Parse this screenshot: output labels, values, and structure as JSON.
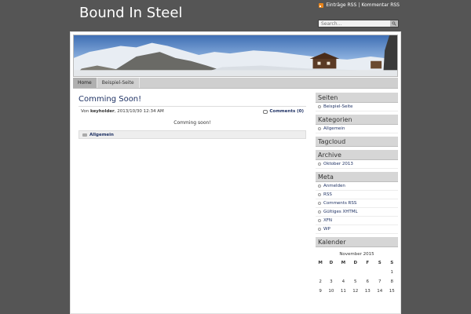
{
  "site": {
    "title": "Bound In Steel"
  },
  "header": {
    "rss_entries": "Einträge RSS",
    "separator": "|",
    "rss_comments": "Kommentar RSS",
    "search_placeholder": "Search..."
  },
  "nav": {
    "items": [
      {
        "label": "Home",
        "active": true
      },
      {
        "label": "Beispiel-Seite",
        "active": false
      }
    ]
  },
  "post": {
    "title": "Comming Soon!",
    "author_prefix": "Von",
    "author": "keyholder",
    "date": ", 2013/10/30 12:34 AM",
    "comments": "Comments (0)",
    "body": "Comming soon!",
    "category": "Allgemein"
  },
  "sidebar": {
    "pages_title": "Seiten",
    "pages": [
      "Beispiel-Seite"
    ],
    "categories_title": "Kategorien",
    "categories": [
      "Allgemein"
    ],
    "tagcloud_title": "Tagcloud",
    "archive_title": "Archive",
    "archive": [
      "Oktober 2013"
    ],
    "meta_title": "Meta",
    "meta": [
      "Anmelden",
      "RSS",
      "Comments RSS",
      "Gültiges XHTML",
      "XFN",
      "WP"
    ],
    "calendar_title": "Kalender"
  },
  "calendar": {
    "caption": "November 2015",
    "days": [
      "M",
      "D",
      "M",
      "D",
      "F",
      "S",
      "S"
    ],
    "weeks": [
      [
        "",
        "",
        "",
        "",
        "",
        "",
        "1"
      ],
      [
        "2",
        "3",
        "4",
        "5",
        "6",
        "7",
        "8"
      ],
      [
        "9",
        "10",
        "11",
        "12",
        "13",
        "14",
        "15"
      ]
    ]
  },
  "colors": {
    "page_background": "#555555",
    "link": "#1f3264",
    "rss": "#e8841b"
  },
  "icons": [
    "rss-icon",
    "search-icon",
    "comment-icon",
    "folder-icon",
    "bullet-icon"
  ]
}
